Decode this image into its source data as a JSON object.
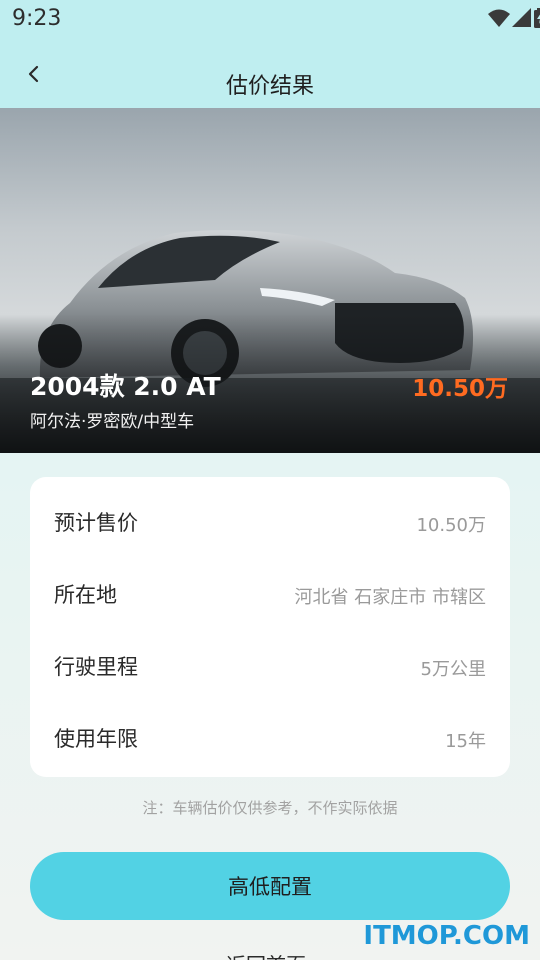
{
  "status_bar": {
    "time": "9:23",
    "icons": [
      "wifi-icon",
      "signal-icon",
      "battery-icon"
    ]
  },
  "header": {
    "title": "估价结果",
    "back_icon": "chevron-left-icon"
  },
  "hero": {
    "model": "2004款 2.0 AT",
    "description": "阿尔法·罗密欧/中型车",
    "price": "10.50万",
    "price_color": "#ff6b21"
  },
  "details": [
    {
      "label": "预计售价",
      "value": "10.50万"
    },
    {
      "label": "所在地",
      "value": "河北省 石家庄市 市辖区"
    },
    {
      "label": "行驶里程",
      "value": "5万公里"
    },
    {
      "label": "使用年限",
      "value": "15年"
    }
  ],
  "note": "注：车辆估价仅供参考，不作实际依据",
  "buttons": {
    "config": "高低配置",
    "home": "返回首页"
  },
  "watermark": "ITMOP.COM",
  "colors": {
    "accent": "#52d2e4",
    "header_bg": "#bfeef0"
  }
}
